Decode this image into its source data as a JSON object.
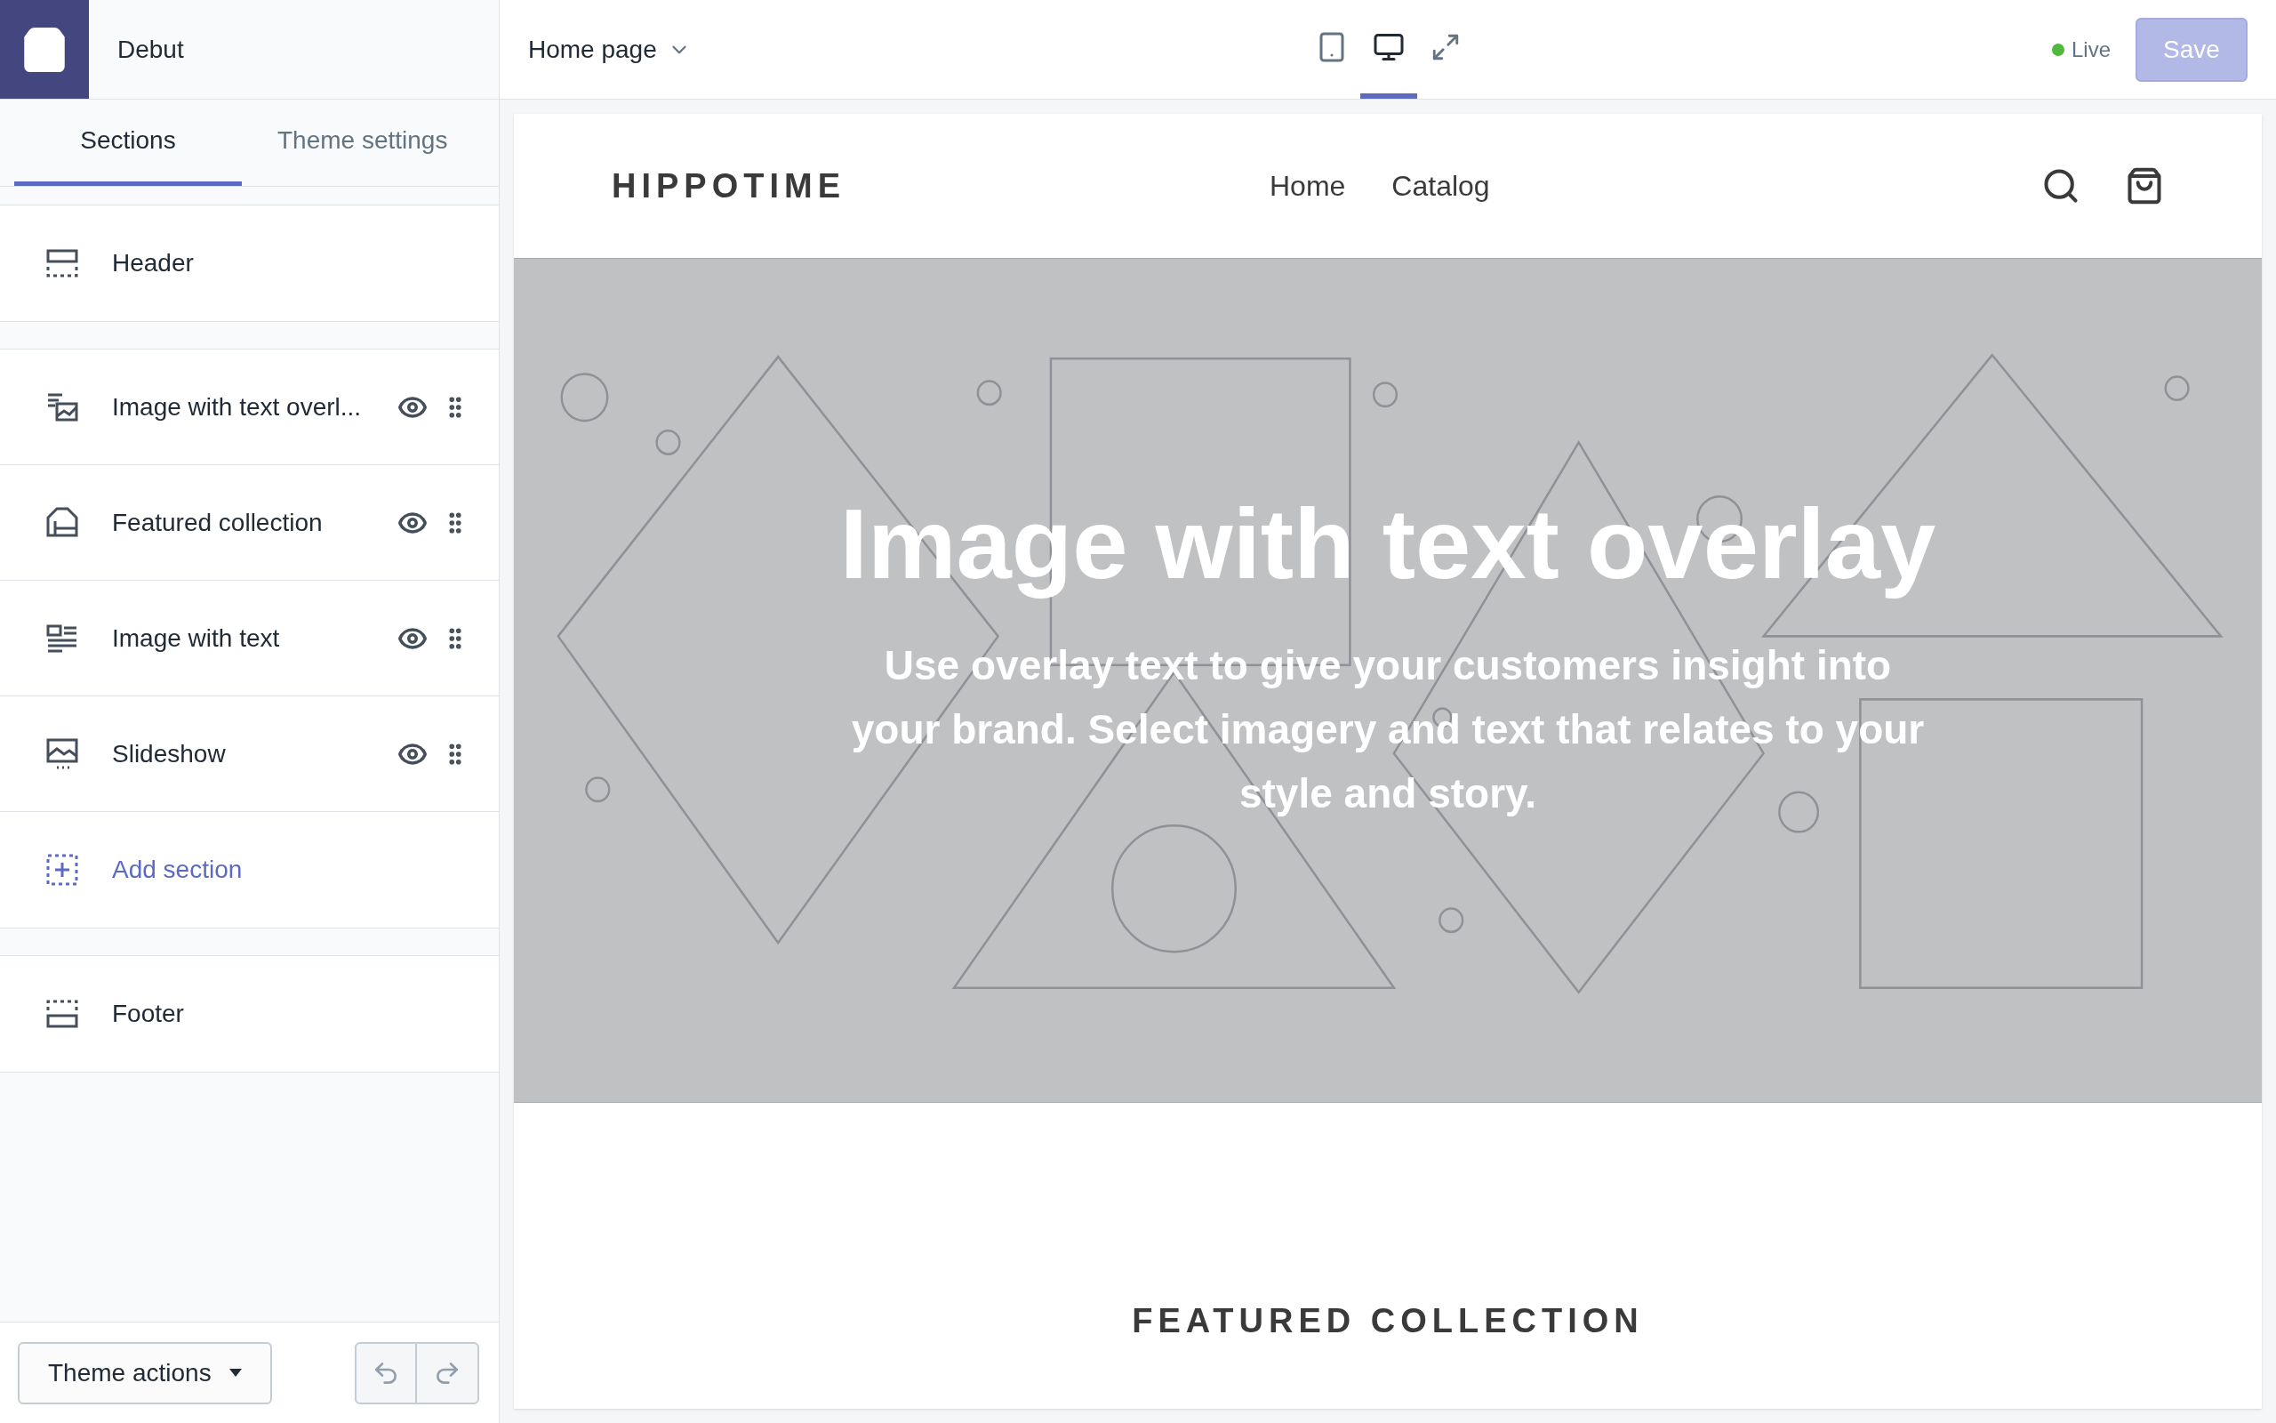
{
  "app": {
    "theme_name": "Debut"
  },
  "sidebar": {
    "tabs": [
      {
        "label": "Sections",
        "selected": true
      },
      {
        "label": "Theme settings",
        "selected": false
      }
    ],
    "groups": [
      [
        {
          "kind": "header",
          "label": "Header"
        }
      ],
      [
        {
          "kind": "overlay",
          "label": "Image with text overl...",
          "visible": true
        },
        {
          "kind": "collection",
          "label": "Featured collection",
          "visible": true
        },
        {
          "kind": "image_text",
          "label": "Image with text",
          "visible": true
        },
        {
          "kind": "slideshow",
          "label": "Slideshow",
          "visible": true
        },
        {
          "kind": "add",
          "label": "Add section"
        }
      ],
      [
        {
          "kind": "footer",
          "label": "Footer"
        }
      ]
    ],
    "theme_actions": "Theme actions"
  },
  "toolbar": {
    "page": "Home page",
    "devices": [
      {
        "kind": "mobile",
        "selected": false
      },
      {
        "kind": "desktop",
        "selected": true
      },
      {
        "kind": "fullscreen",
        "selected": false
      }
    ],
    "status": {
      "label": "Live",
      "color": "#50b83c"
    },
    "save": {
      "label": "Save",
      "disabled": true
    }
  },
  "preview": {
    "brand": "HIPPOTIME",
    "nav": [
      "Home",
      "Catalog"
    ],
    "hero": {
      "title": "Image with text overlay",
      "text": "Use overlay text to give your customers insight into your brand. Select imagery and text that relates to your style and story."
    },
    "featured_heading": "FEATURED COLLECTION"
  }
}
